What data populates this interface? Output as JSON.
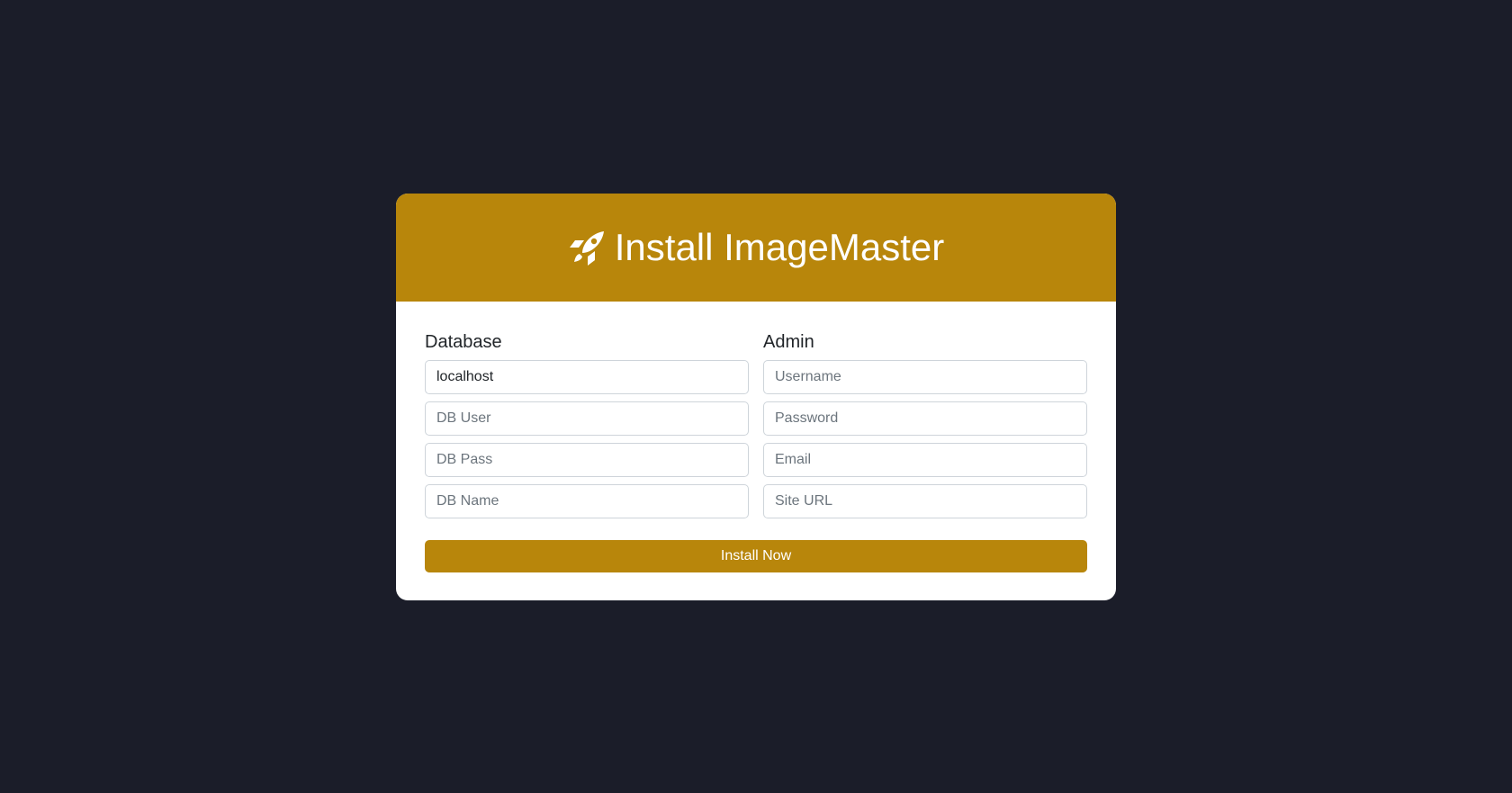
{
  "header": {
    "icon": "rocket-icon",
    "title": "Install ImageMaster"
  },
  "database": {
    "title": "Database",
    "host": {
      "value": "localhost",
      "placeholder": ""
    },
    "user": {
      "value": "",
      "placeholder": "DB User"
    },
    "pass": {
      "value": "",
      "placeholder": "DB Pass"
    },
    "name": {
      "value": "",
      "placeholder": "DB Name"
    }
  },
  "admin": {
    "title": "Admin",
    "username": {
      "value": "",
      "placeholder": "Username"
    },
    "password": {
      "value": "",
      "placeholder": "Password"
    },
    "email": {
      "value": "",
      "placeholder": "Email"
    },
    "site_url": {
      "value": "",
      "placeholder": "Site URL"
    }
  },
  "actions": {
    "install_label": "Install Now"
  },
  "colors": {
    "accent": "#b8860b",
    "background": "#1b1d29",
    "card": "#ffffff"
  }
}
